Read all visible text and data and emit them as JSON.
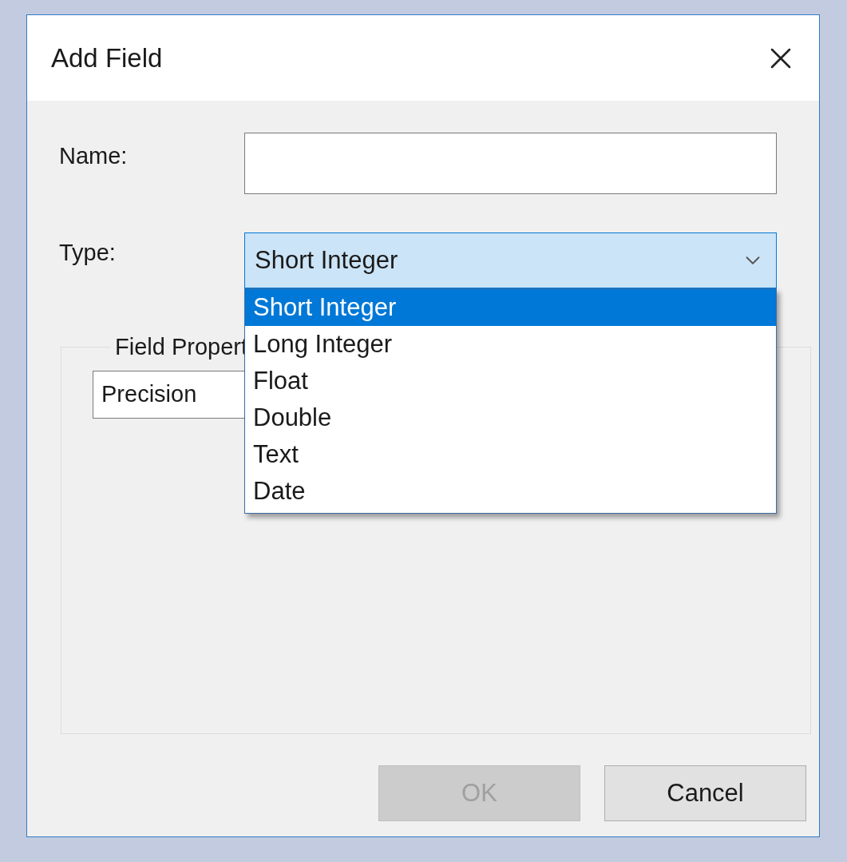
{
  "dialog": {
    "title": "Add Field"
  },
  "name_field": {
    "label": "Name:"
  },
  "type_field": {
    "label": "Type:",
    "value": "Short Integer",
    "expanded": true
  },
  "type_options": [
    {
      "label": "Short Integer",
      "selected": true
    },
    {
      "label": "Long Integer",
      "selected": false
    },
    {
      "label": "Float",
      "selected": false
    },
    {
      "label": "Double",
      "selected": false
    },
    {
      "label": "Text",
      "selected": false
    },
    {
      "label": "Date",
      "selected": false
    }
  ],
  "field_properties": {
    "title": "Field Propert",
    "rows": [
      {
        "label": "Precision"
      }
    ]
  },
  "buttons": [
    {
      "label": "OK",
      "disabled": true
    },
    {
      "label": "Cancel",
      "disabled": false
    }
  ]
}
